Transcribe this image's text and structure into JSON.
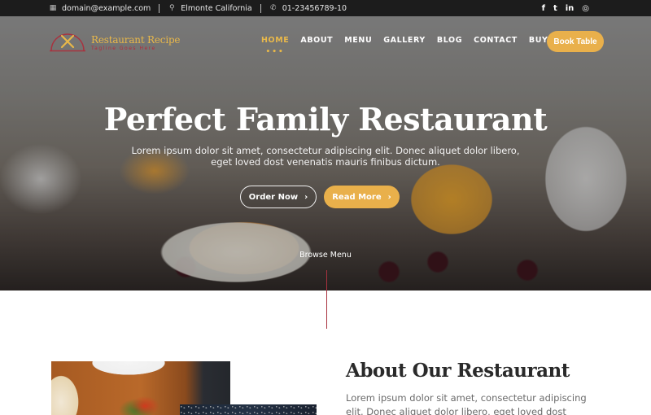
{
  "topbar": {
    "email": "domain@example.com",
    "email_icon": "calendar-icon",
    "location": "Elmonte California",
    "location_icon": "map-pin-icon",
    "phone": "01-23456789-10",
    "phone_icon": "phone-icon",
    "social": [
      {
        "name": "facebook-icon",
        "glyph": "f"
      },
      {
        "name": "twitter-icon",
        "glyph": "t"
      },
      {
        "name": "linkedin-icon",
        "glyph": "in"
      },
      {
        "name": "instagram-icon",
        "glyph": "◎"
      }
    ]
  },
  "logo": {
    "brand": "Restaurant Recipe",
    "tagline": "Tagline Goes Here"
  },
  "nav": {
    "items": [
      {
        "label": "HOME",
        "active": true
      },
      {
        "label": "ABOUT"
      },
      {
        "label": "MENU"
      },
      {
        "label": "GALLERY"
      },
      {
        "label": "BLOG"
      },
      {
        "label": "CONTACT"
      },
      {
        "label": "BUY PRO"
      }
    ],
    "active_indicator": "•••",
    "book_label": "Book Table"
  },
  "hero": {
    "title": "Perfect Family Restaurant",
    "subtitle": "Lorem ipsum dolor sit amet, consectetur adipiscing elit. Donec aliquet dolor libero, eget loved dost venenatis mauris finibus dictum.",
    "order_label": "Order Now",
    "read_label": "Read More",
    "chevron": "›",
    "browse_label": "Browse Menu"
  },
  "about": {
    "title": "About Our Restaurant",
    "text": "Lorem ipsum dolor sit amet, consectetur adipiscing elit. Donec aliquet dolor libero, eget loved dost"
  },
  "colors": {
    "accent": "#e9b04b",
    "brand_red": "#a8323f",
    "topbar_bg": "#1c1c1c",
    "heading": "#2a2a2a"
  }
}
